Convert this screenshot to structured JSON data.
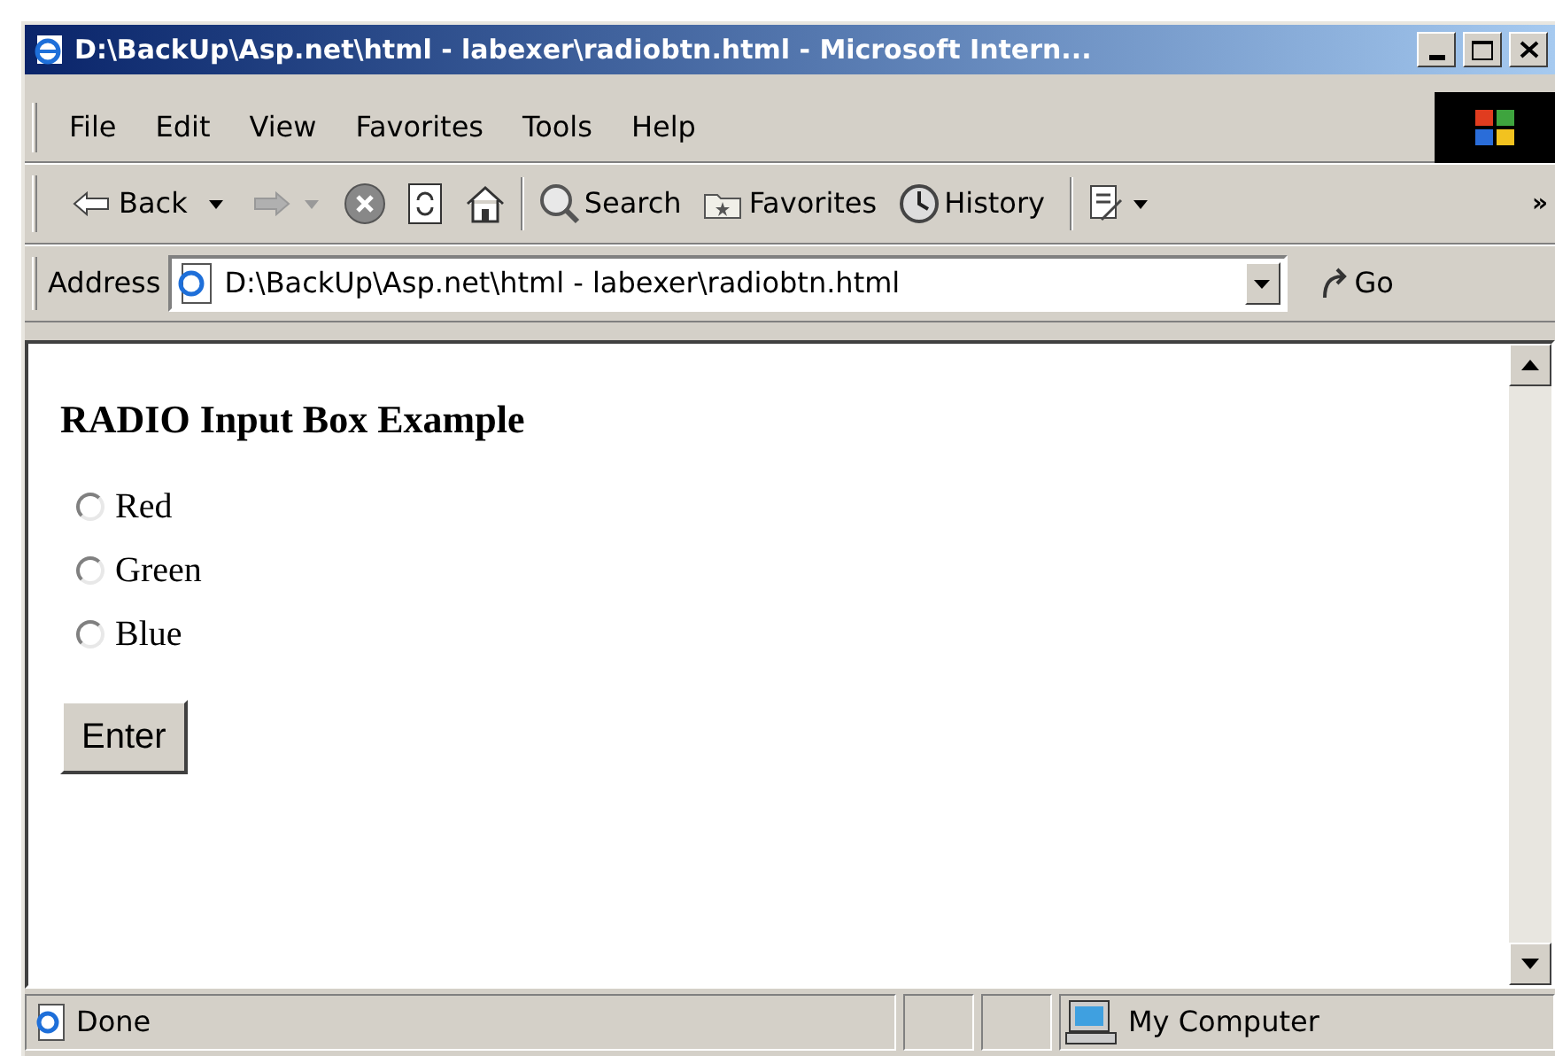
{
  "window": {
    "title": "D:\\BackUp\\Asp.net\\html - labexer\\radiobtn.html - Microsoft Intern..."
  },
  "menu": [
    "File",
    "Edit",
    "View",
    "Favorites",
    "Tools",
    "Help"
  ],
  "toolbar": {
    "back": "Back",
    "search": "Search",
    "favorites": "Favorites",
    "history": "History",
    "more": "»"
  },
  "address": {
    "label": "Address",
    "value": "D:\\BackUp\\Asp.net\\html - labexer\\radiobtn.html",
    "go": "Go"
  },
  "page": {
    "heading": "RADIO Input Box Example",
    "options": [
      {
        "label": "Red",
        "checked": false
      },
      {
        "label": "Green",
        "checked": false
      },
      {
        "label": "Blue",
        "checked": false
      }
    ],
    "button": "Enter"
  },
  "status_bar": {
    "text": "Done",
    "zone": "My Computer"
  }
}
